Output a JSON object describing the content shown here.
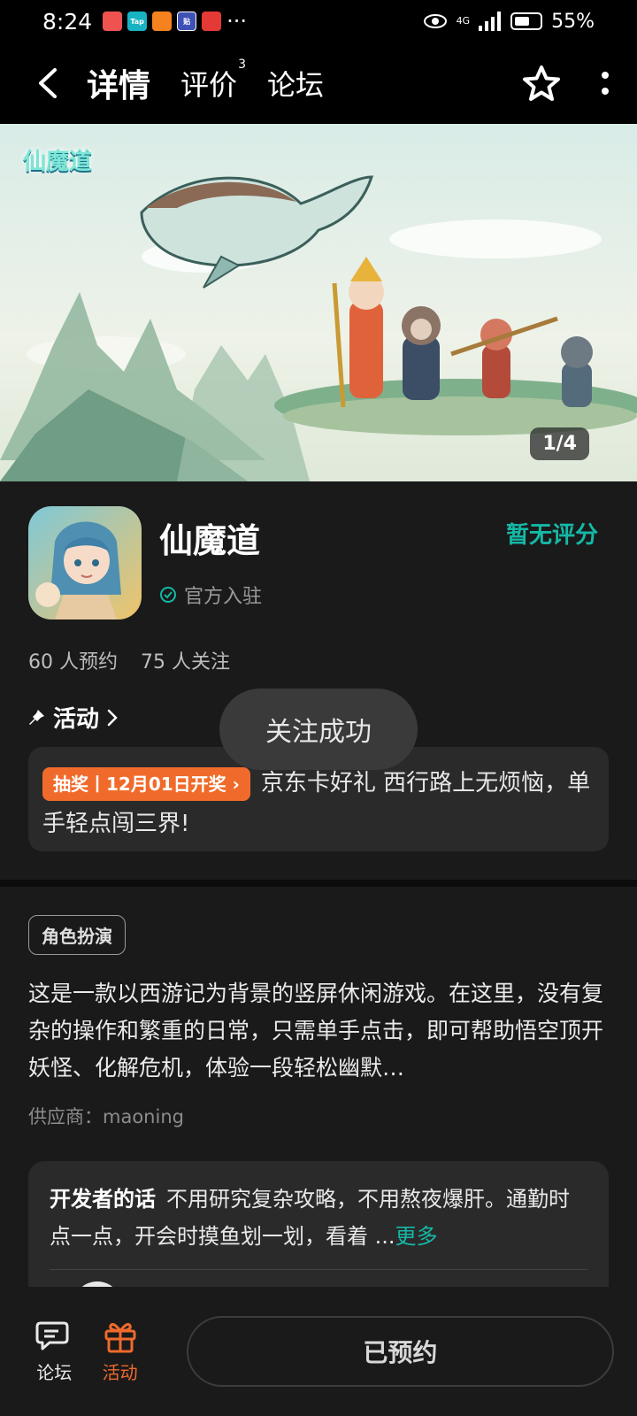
{
  "status_bar": {
    "time": "8:24",
    "notif_labels": [
      "",
      "Tap",
      "",
      "贴",
      ""
    ],
    "more": "···",
    "network": "4G",
    "battery": "55%"
  },
  "header": {
    "tabs": [
      {
        "label": "详情",
        "active": true
      },
      {
        "label": "评价",
        "badge": "3"
      },
      {
        "label": "论坛"
      }
    ]
  },
  "banner": {
    "logo_text": "仙魔道",
    "counter": "1/4"
  },
  "game": {
    "title": "仙魔道",
    "official": "官方入驻",
    "rating": "暂无评分",
    "reservations": "60 人预约",
    "followers": "75 人关注"
  },
  "activity": {
    "heading": "活动",
    "tag": "抽奖丨12月01日开奖",
    "text": "京东卡好礼 西行路上无烦恼，单手轻点闯三界!"
  },
  "toast": "关注成功",
  "description": {
    "genre": "角色扮演",
    "text": "这是一款以西游记为背景的竖屏休闲游戏。在这里，没有复杂的操作和繁重的日常，只需单手点击，即可帮助悟空顶开妖怪、化解危机，体验一段轻松幽默…",
    "supplier": "供应商：maoning"
  },
  "developer": {
    "label": "开发者的话",
    "text": "不用研究复杂攻略，不用熬夜爆肝。通勤时点一点，开会时摸鱼划一划，看着 ...",
    "more": "更多"
  },
  "bottom": {
    "forum": "论坛",
    "activity": "活动",
    "reserve": "已预约"
  },
  "colors": {
    "accent": "#14b9a6",
    "orange": "#ef6a2c"
  }
}
